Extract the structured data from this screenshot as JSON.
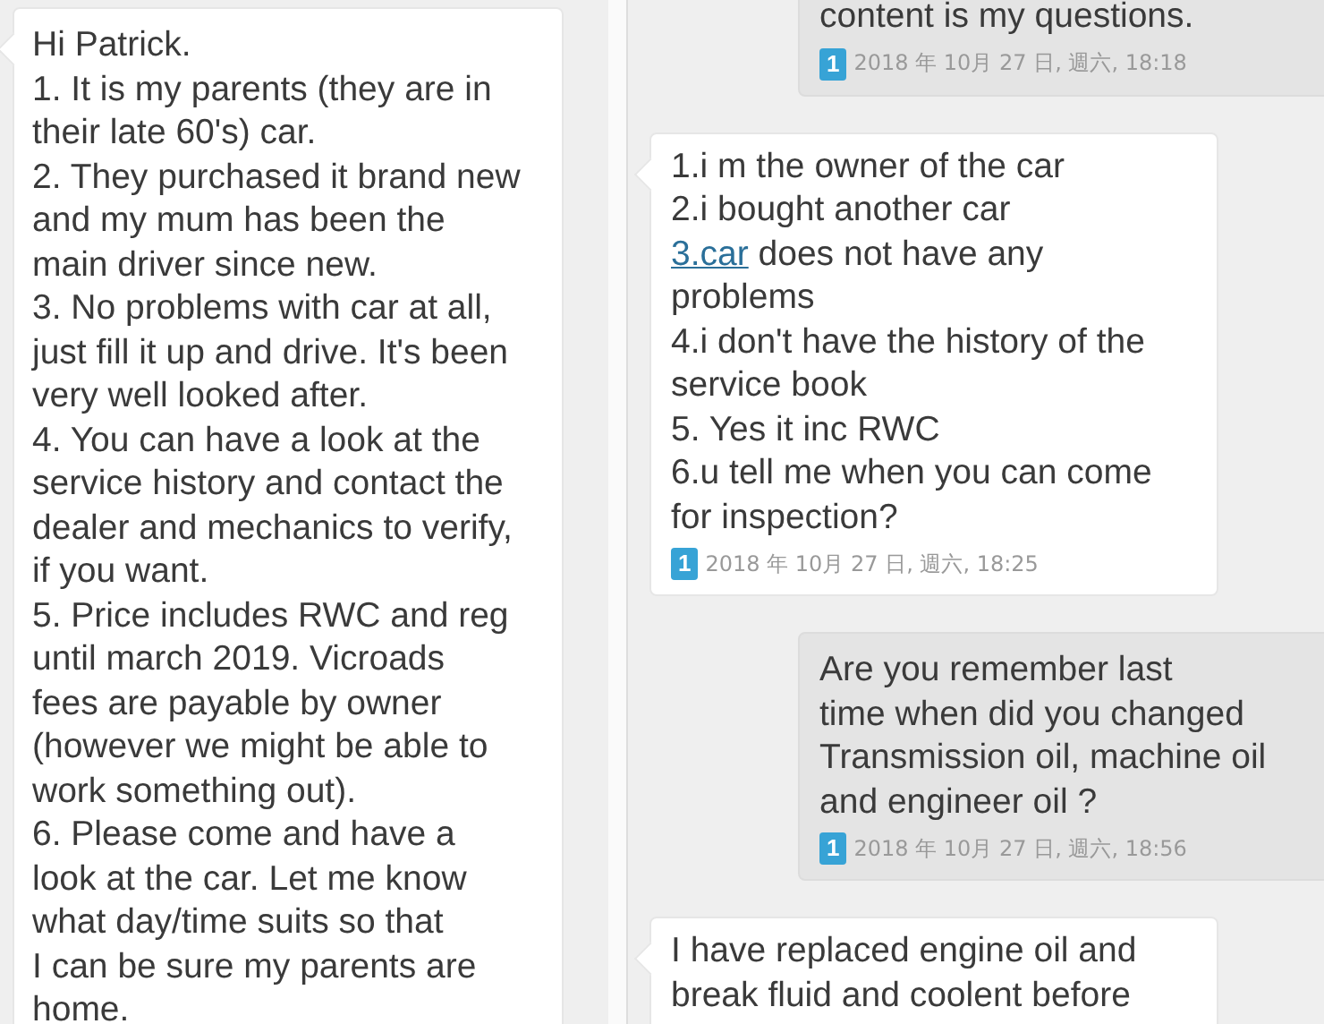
{
  "left_panel": {
    "messages": [
      {
        "kind": "incoming",
        "segments": [
          {
            "kind": "text",
            "text": "Hi Patrick.\n1. It is my parents (they are in\ntheir late 60's) car.\n2. They purchased it brand new\nand my mum has been the\nmain driver since new.\n3. No problems with car at all,\njust fill it up and drive. It's been\nvery well looked after.\n4. You can have a look at the\nservice history and contact the\ndealer and mechanics to verify,\nif you want.\n5. Price includes RWC and reg\nuntil march 2019. Vicroads\nfees are payable by owner\n(however we might be able to\nwork something out).\n6. Please come and have a\nlook at the car. Let me know\nwhat day/time suits so that\nI can be sure my parents are\nhome."
          }
        ]
      }
    ]
  },
  "right_panel": {
    "messages": [
      {
        "kind": "outgoing",
        "segments": [
          {
            "kind": "text",
            "text": "content is my questions."
          }
        ],
        "sim": "1",
        "time": "2018 年 10月 27 日, 週六, 18:18"
      },
      {
        "kind": "incoming",
        "segments": [
          {
            "kind": "text",
            "text": "1.i m the owner of the car\n2.i bought another car\n"
          },
          {
            "kind": "link",
            "text": "3.car"
          },
          {
            "kind": "text",
            "text": " does not have any\nproblems\n4.i don't have the history of the\nservice book\n5. Yes it inc RWC\n6.u tell me when you can come\nfor inspection?"
          }
        ],
        "sim": "1",
        "time": "2018 年 10月 27 日, 週六, 18:25"
      },
      {
        "kind": "outgoing",
        "segments": [
          {
            "kind": "text",
            "text": "Are you remember last\ntime when did you changed\nTransmission oil, machine oil\nand engineer oil ?"
          }
        ],
        "sim": "1",
        "time": "2018 年 10月 27 日, 週六, 18:56"
      },
      {
        "kind": "incoming",
        "segments": [
          {
            "kind": "text",
            "text": "I have replaced engine oil and\nbreak fluid and coolent before"
          }
        ]
      }
    ]
  }
}
